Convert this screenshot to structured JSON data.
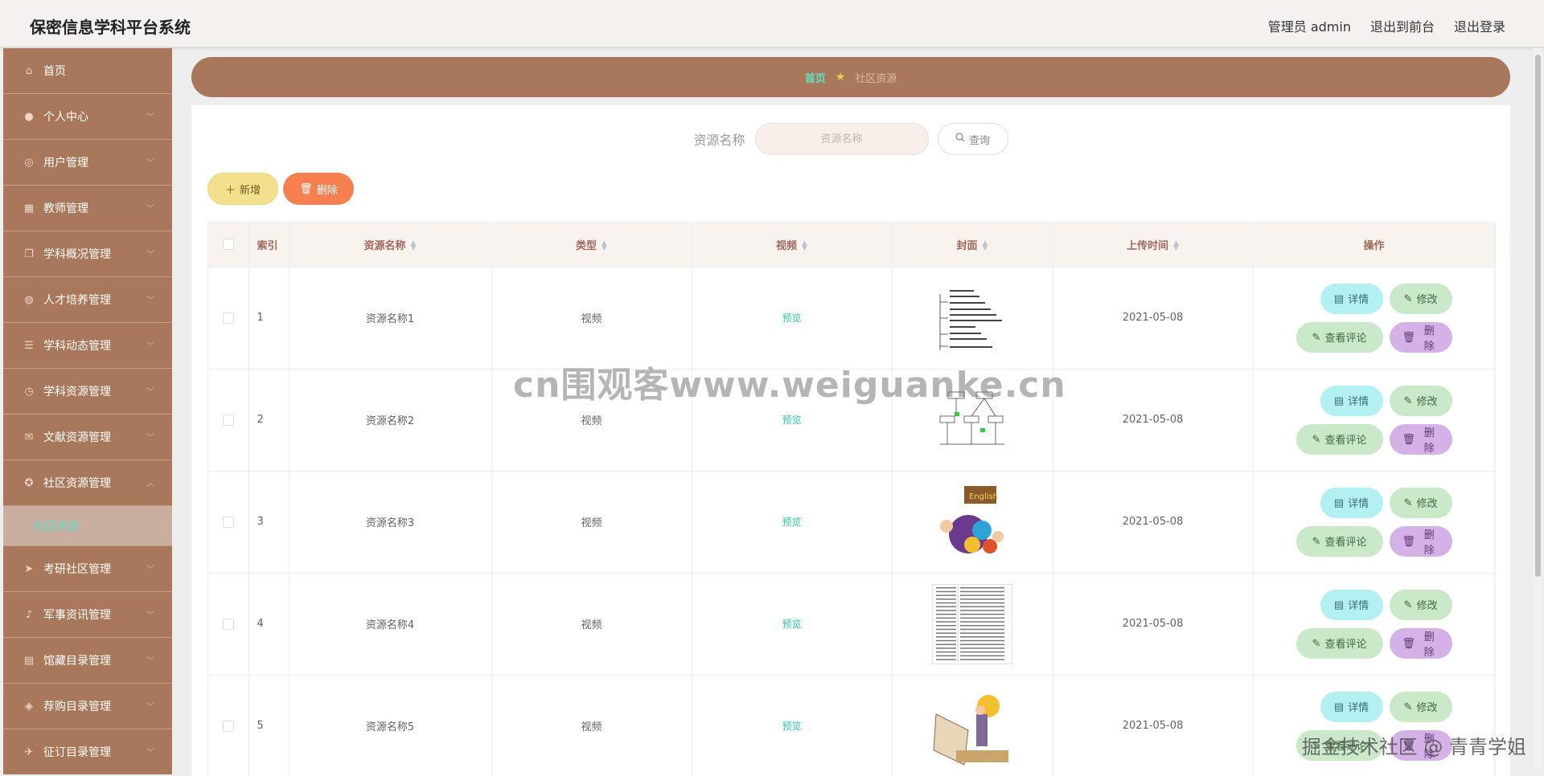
{
  "header": {
    "title": "保密信息学科平台系统",
    "user_label": "管理员 admin",
    "front_link": "退出到前台",
    "logout_link": "退出登录"
  },
  "sidebar": {
    "items": [
      {
        "label": "首页",
        "icon": "home-icon"
      },
      {
        "label": "个人中心",
        "icon": "user-icon"
      },
      {
        "label": "用户管理",
        "icon": "user-circle-icon"
      },
      {
        "label": "教师管理",
        "icon": "grid-icon"
      },
      {
        "label": "学科概况管理",
        "icon": "copy-icon"
      },
      {
        "label": "人才培养管理",
        "icon": "globe-icon"
      },
      {
        "label": "学科动态管理",
        "icon": "list-icon"
      },
      {
        "label": "学科资源管理",
        "icon": "clock-icon"
      },
      {
        "label": "文献资源管理",
        "icon": "mail-icon"
      },
      {
        "label": "社区资源管理",
        "icon": "compass-icon"
      }
    ],
    "active_sub": "社区资源",
    "items_after": [
      {
        "label": "考研社区管理",
        "icon": "send-icon"
      },
      {
        "label": "军事资讯管理",
        "icon": "mic-icon"
      },
      {
        "label": "馆藏目录管理",
        "icon": "book-icon"
      },
      {
        "label": "荐购目录管理",
        "icon": "bag-icon"
      },
      {
        "label": "征订目录管理",
        "icon": "plane-icon"
      }
    ]
  },
  "breadcrumb": {
    "home": "首页",
    "current": "社区资源"
  },
  "search": {
    "label": "资源名称",
    "placeholder": "资源名称",
    "button": "查询"
  },
  "actions": {
    "add": "新增",
    "delete": "删除"
  },
  "table": {
    "headers": {
      "index": "索引",
      "name": "资源名称",
      "type": "类型",
      "video": "视频",
      "cover": "封面",
      "upload_time": "上传时间",
      "ops": "操作"
    },
    "row_actions": {
      "detail": "详情",
      "edit": "修改",
      "comments": "查看评论",
      "delete": "删除"
    },
    "rows": [
      {
        "index": "1",
        "name": "资源名称1",
        "type": "视频",
        "video": "预览",
        "cover": "mindmap-diagram",
        "upload_time": "2021-05-08"
      },
      {
        "index": "2",
        "name": "资源名称2",
        "type": "视频",
        "video": "预览",
        "cover": "flowchart-diagram",
        "upload_time": "2021-05-08"
      },
      {
        "index": "3",
        "name": "资源名称3",
        "type": "视频",
        "video": "预览",
        "cover": "english-kids-illustration",
        "upload_time": "2021-05-08"
      },
      {
        "index": "4",
        "name": "资源名称4",
        "type": "视频",
        "video": "预览",
        "cover": "document-table",
        "upload_time": "2021-05-08"
      },
      {
        "index": "5",
        "name": "资源名称5",
        "type": "视频",
        "video": "预览",
        "cover": "reading-illustration",
        "upload_time": "2021-05-08"
      }
    ]
  },
  "watermark": "cn围观客www.weiguanke.cn",
  "credit": "掘金技术社区 @ 青青学姐",
  "colors": {
    "sidebar_bg": "#a9775a",
    "accent_teal": "#5fe1c8",
    "add_button": "#f3e08d",
    "delete_button": "#f77f50",
    "detail_button": "#b2f0f3",
    "edit_button": "#c9e9c8",
    "row_delete_button": "#d4b2e8"
  }
}
